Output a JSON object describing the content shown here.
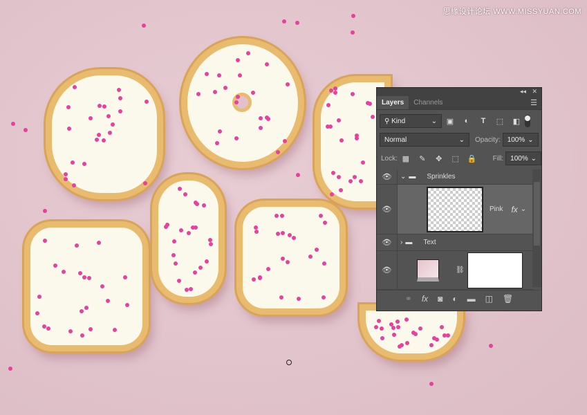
{
  "watermark": "思缘设计论坛  WWW.MISSYUAN.COM",
  "colors": {
    "background": "#e3c5cd",
    "icing": "#fbf8ec",
    "crust": "#e9bb6e",
    "sprinkle": "#e8409c",
    "panel": "#535353"
  },
  "panel": {
    "tabs": [
      {
        "label": "Layers",
        "active": true
      },
      {
        "label": "Channels",
        "active": false
      }
    ],
    "filter": {
      "label": "Kind",
      "icons": [
        "image-filter-icon",
        "adjustment-filter-icon",
        "type-filter-icon",
        "shape-filter-icon",
        "smart-object-filter-icon"
      ]
    },
    "blend_mode": "Normal",
    "opacity_label": "Opacity:",
    "opacity": "100%",
    "lock_label": "Lock:",
    "fill_label": "Fill:",
    "fill": "100%",
    "layers": [
      {
        "name": "Sprinkles",
        "type": "group",
        "expanded": true
      },
      {
        "name": "Pink",
        "type": "layer",
        "fx": "fx",
        "selected": true
      },
      {
        "name": "Text",
        "type": "group",
        "expanded": false
      },
      {
        "name": "",
        "type": "adjustment"
      }
    ],
    "footer_icons": [
      "link-icon",
      "fx-icon",
      "mask-icon",
      "adjustment-icon",
      "folder-icon",
      "new-layer-icon",
      "trash-icon"
    ]
  }
}
